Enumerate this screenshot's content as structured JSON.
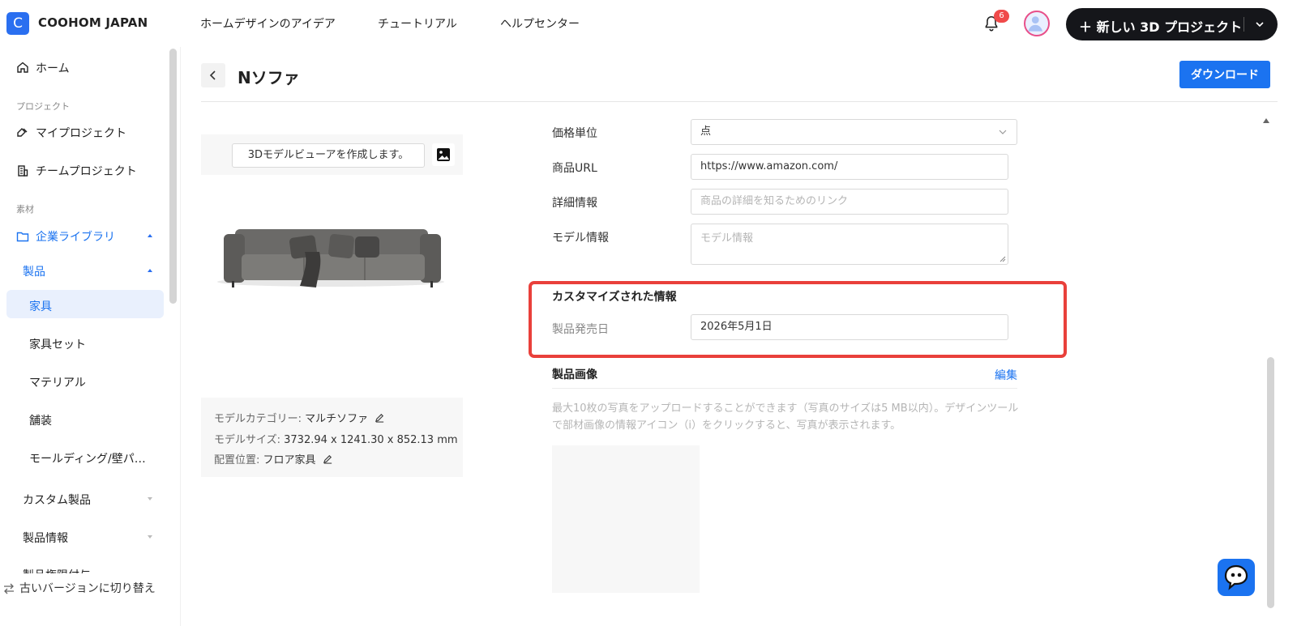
{
  "app": {
    "logo_letter": "C",
    "brand": "COOHOM JAPAN",
    "nav": [
      "ホームデザインのアイデア",
      "チュートリアル",
      "ヘルプセンター"
    ],
    "notification_count": "6",
    "new_project_label": "＋ 新しい 3D プロジェクト"
  },
  "sidebar": {
    "home": "ホーム",
    "section_project": "プロジェクト",
    "my_projects": "マイプロジェクト",
    "team_projects": "チームプロジェクト",
    "section_material": "素材",
    "enterprise_library": "企業ライブラリ",
    "products": "製品",
    "sub_items": [
      "家具",
      "家具セット",
      "マテリアル",
      "舗装",
      "モールディング/壁パ…"
    ],
    "custom_products": "カスタム製品",
    "product_info": "製品情報",
    "product_permissions": "製品権限付与",
    "switch_version": "古いバージョンに切り替え"
  },
  "page": {
    "title": "Nソファ",
    "download": "ダウンロード"
  },
  "preview": {
    "viewer_button": "3Dモデルビューアを作成します。",
    "category_label": "モデルカテゴリー:",
    "category_value": "マルチソファ",
    "size_label": "モデルサイズ:",
    "size_value": "3732.94 x 1241.30 x 852.13 mm",
    "placement_label": "配置位置:",
    "placement_value": "フロア家具"
  },
  "form": {
    "price_unit_label": "価格単位",
    "price_unit_value": "点",
    "url_label": "商品URL",
    "url_value": "https://www.amazon.com/",
    "detail_label": "詳細情報",
    "detail_placeholder": "商品の詳細を知るためのリンク",
    "model_info_label": "モデル情報",
    "model_info_placeholder": "モデル情報"
  },
  "custom_info": {
    "title": "カスタマイズされた情報",
    "release_date_label": "製品発売日",
    "release_date_value": "2026年5月1日"
  },
  "product_images": {
    "title": "製品画像",
    "edit": "編集",
    "hint": "最大10枚の写真をアップロードすることができます（写真のサイズは5 MB以内）。デザインツールで部材画像の情報アイコン（i）をクリックすると、写真が表示されます。"
  },
  "colors": {
    "accent": "#1b73f0",
    "highlight": "#e9403b",
    "active_bg": "#e9f0fd"
  }
}
